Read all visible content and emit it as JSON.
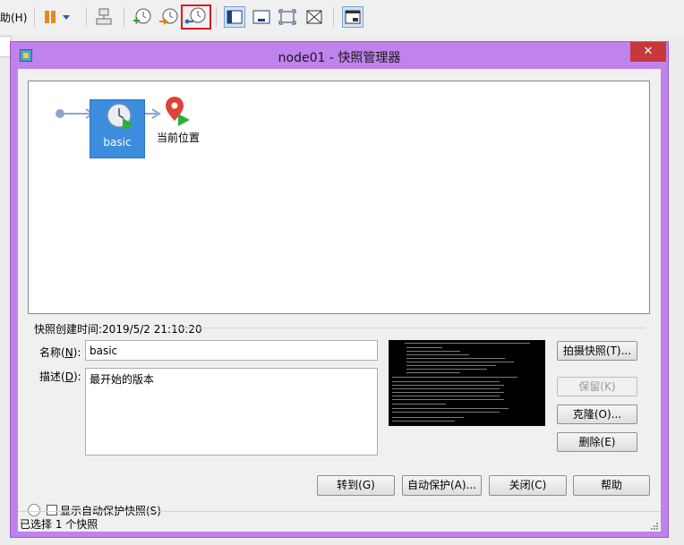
{
  "host": {
    "menu_fragment": "助(H)"
  },
  "dialog": {
    "title": "node01 - 快照管理器",
    "close_glyph": "✕"
  },
  "snapshot_tree": {
    "snapshot": {
      "name": "basic"
    },
    "current_position_label": "当前位置"
  },
  "details": {
    "created_label": "快照创建时间:2019/5/2 21:10:20",
    "name_label": {
      "text": "名称(",
      "key": "N",
      "end": "):"
    },
    "name_value": "basic",
    "desc_label": {
      "text": "描述(",
      "key": "D",
      "end": "):"
    },
    "desc_value": "最开始的版本"
  },
  "buttons": {
    "take_snapshot": "拍摄快照(T)...",
    "keep": "保留(K)",
    "clone": "克隆(O)...",
    "delete": "删除(E)",
    "goto": "转到(G)",
    "auto_protect": "自动保护(A)...",
    "close": "关闭(C)",
    "help": "帮助"
  },
  "show_autoprotect": {
    "label": "显示自动保护快照(S)",
    "checked": false
  },
  "status": {
    "text": "已选择 1 个快照"
  },
  "icons": {
    "pause": "pause-icon",
    "dropdown": "chevron-down-icon",
    "network": "network-icon",
    "take_snapshot": "snapshot-add-icon",
    "revert": "snapshot-revert-icon",
    "manager": "snapshot-manager-icon",
    "sidebar": "sidebar-icon",
    "console": "console-icon",
    "fullscreen": "fullscreen-icon",
    "unity": "unity-icon",
    "thumbnail": "thumbnail-view-icon"
  },
  "colors": {
    "dialog_frame": "#c082ec",
    "node_fill": "#3c8dde",
    "close_button": "#c7383c",
    "highlight": "#e0161e"
  }
}
